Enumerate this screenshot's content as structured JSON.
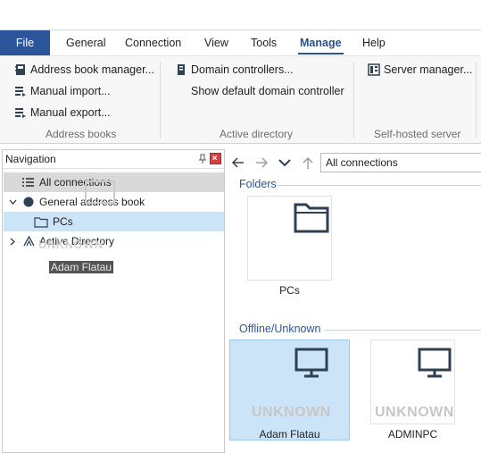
{
  "ribbon": {
    "tabs": [
      {
        "label": "File"
      },
      {
        "label": "General"
      },
      {
        "label": "Connection"
      },
      {
        "label": "View"
      },
      {
        "label": "Tools"
      },
      {
        "label": "Manage"
      },
      {
        "label": "Help"
      }
    ],
    "active_tab": "Manage",
    "groups": {
      "address_books": {
        "label": "Address books",
        "buttons": [
          "Address book manager...",
          "Manual import...",
          "Manual export..."
        ]
      },
      "active_directory": {
        "label": "Active directory",
        "buttons": [
          "Domain controllers...",
          "Show default domain controller"
        ]
      },
      "self_hosted": {
        "label": "Self-hosted server",
        "buttons": [
          "Server manager..."
        ]
      }
    }
  },
  "navigation": {
    "title": "Navigation",
    "tree": [
      {
        "label": "All connections",
        "icon": "list-icon"
      },
      {
        "label": "General address book",
        "icon": "address-book-icon",
        "expanded": true
      },
      {
        "label": "PCs",
        "icon": "folder-icon"
      },
      {
        "label": "Active Directory",
        "icon": "active-directory-icon",
        "expanded": false
      }
    ],
    "drag_ghost": {
      "label": "Adam Flatau",
      "status": "UNKNOWN"
    }
  },
  "content": {
    "address_value": "All connections",
    "folders_header": "Folders",
    "offline_header": "Offline/Unknown",
    "folders": [
      {
        "name": "PCs"
      }
    ],
    "devices": [
      {
        "name": "Adam Flatau",
        "status": "UNKNOWN"
      },
      {
        "name": "ADMINPC",
        "status": "UNKNOWN"
      }
    ]
  },
  "colors": {
    "accent": "#2b579a",
    "selection": "#cce4f7",
    "icon": "#2f4050"
  }
}
